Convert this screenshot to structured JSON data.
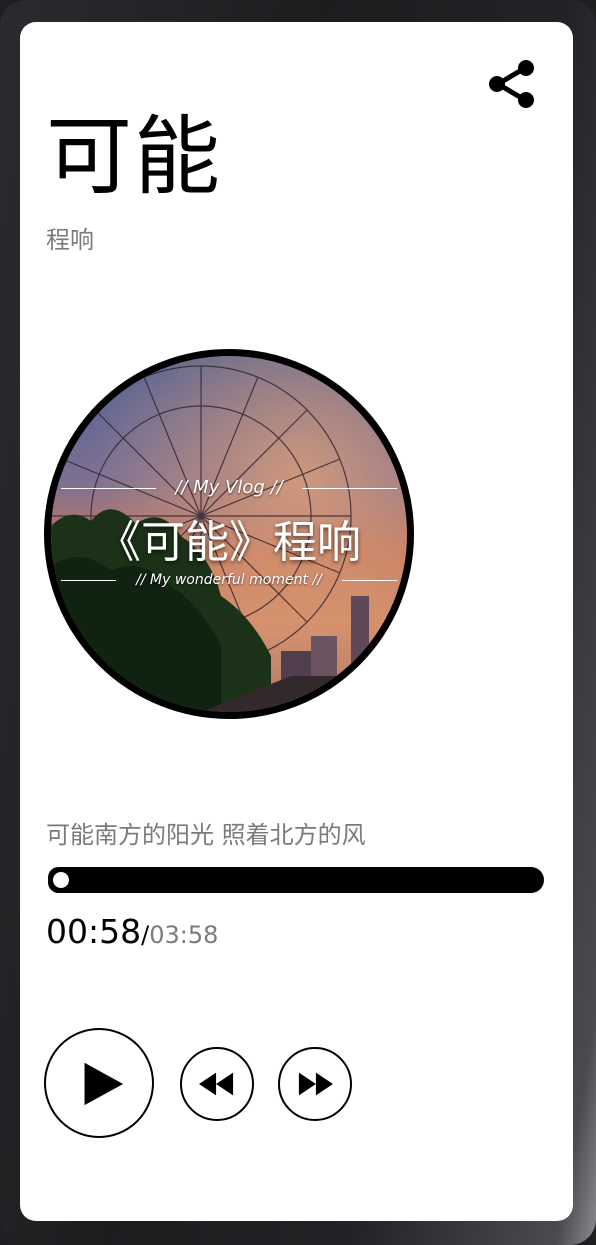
{
  "song": {
    "title": "可能",
    "artist": "程响"
  },
  "cover": {
    "vlog_text": "// My Vlog //",
    "main_text": "《可能》程响",
    "moment_text": "// My wonderful moment //"
  },
  "lyric": {
    "current_line": "可能南方的阳光  照着北方的风"
  },
  "playback": {
    "current_time": "00:58",
    "separator": "/",
    "total_time": "03:58",
    "progress_fraction": 0.0
  },
  "controls": {
    "play_icon": "play-icon",
    "rewind_icon": "rewind-icon",
    "fast_forward_icon": "fast-forward-icon",
    "share_icon": "share-icon"
  },
  "colors": {
    "text_primary": "#000000",
    "text_secondary": "#7b7b7b",
    "card_background": "#ffffff",
    "progress_track": "#000000"
  }
}
